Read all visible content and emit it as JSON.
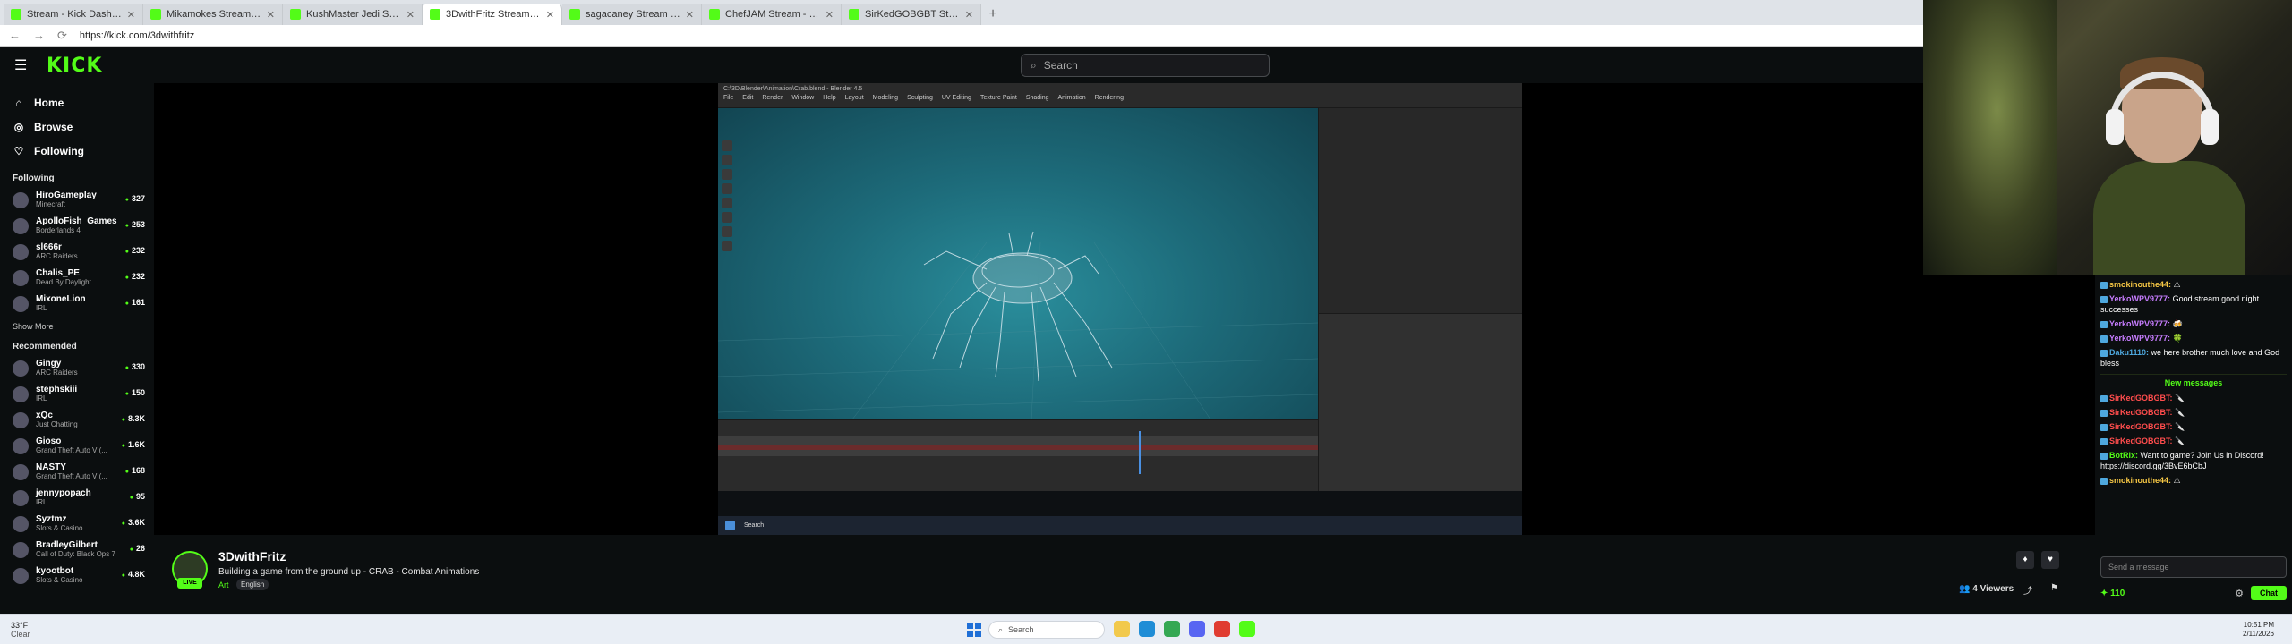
{
  "browser": {
    "tabs": [
      {
        "title": "Stream - Kick Dashboard",
        "active": false
      },
      {
        "title": "Mikamokes Stream - Watch Live o...",
        "active": false
      },
      {
        "title": "KushMaster Jedi Stream - Watch Li...",
        "active": false
      },
      {
        "title": "3DwithFritz Stream - Watch Live o...",
        "active": true
      },
      {
        "title": "sagacaney Stream - Watch Live o...",
        "active": false
      },
      {
        "title": "ChefJAM Stream - Watch Live on K...",
        "active": false
      },
      {
        "title": "SirKedGOBGBT Stream - Watch Live...",
        "active": false
      }
    ],
    "url": "https://kick.com/3dwithfritz"
  },
  "header": {
    "logo": "KICK",
    "search_placeholder": "Search"
  },
  "sidebar": {
    "nav": [
      {
        "label": "Home",
        "icon": "home-icon"
      },
      {
        "label": "Browse",
        "icon": "compass-icon"
      },
      {
        "label": "Following",
        "icon": "heart-icon"
      }
    ],
    "following_title": "Following",
    "following": [
      {
        "name": "HiroGameplay",
        "category": "Minecraft",
        "viewers": "327"
      },
      {
        "name": "ApolloFish_Games",
        "category": "Borderlands 4",
        "viewers": "253"
      },
      {
        "name": "sl666r",
        "category": "ARC Raiders",
        "viewers": "232"
      },
      {
        "name": "Chalis_PE",
        "category": "Dead By Daylight",
        "viewers": "232"
      },
      {
        "name": "MixoneLion",
        "category": "IRL",
        "viewers": "161"
      }
    ],
    "show_more": "Show More",
    "recommended_title": "Recommended",
    "recommended": [
      {
        "name": "Gingy",
        "category": "ARC Raiders",
        "viewers": "330"
      },
      {
        "name": "stephskiii",
        "category": "IRL",
        "viewers": "150"
      },
      {
        "name": "xQc",
        "category": "Just Chatting",
        "viewers": "8.3K"
      },
      {
        "name": "Gioso",
        "category": "Grand Theft Auto V (...",
        "viewers": "1.6K"
      },
      {
        "name": "NASTY",
        "category": "Grand Theft Auto V (...",
        "viewers": "168"
      },
      {
        "name": "jennypopach",
        "category": "IRL",
        "viewers": "95"
      },
      {
        "name": "Syztmz",
        "category": "Slots & Casino",
        "viewers": "3.6K"
      },
      {
        "name": "BradleyGilbert",
        "category": "Call of Duty: Black Ops 7",
        "viewers": "26"
      },
      {
        "name": "kyootbot",
        "category": "Slots & Casino",
        "viewers": "4.8K"
      }
    ]
  },
  "player": {
    "blender_title": "C:\\3D\\Blender\\Animation\\Crab.blend - Blender 4.5",
    "blender_menus": [
      "File",
      "Edit",
      "Render",
      "Window",
      "Help",
      "Layout",
      "Modeling",
      "Sculpting",
      "UV Editing",
      "Texture Paint",
      "Shading",
      "Animation",
      "Rendering"
    ],
    "taskbar_search": "Search"
  },
  "stream": {
    "streamer": "3DwithFritz",
    "live_badge": "LIVE",
    "title": "Building a game from the ground up - CRAB - Combat Animations",
    "category": "Art",
    "tag": "English",
    "viewers": "4 Viewers"
  },
  "chat": {
    "messages": [
      {
        "user": "smokinouthe44:",
        "text": "⚠",
        "color": "#f6c744"
      },
      {
        "user": "YerkoWPV9777:",
        "text": "Good stream good night successes",
        "color": "#c77dff"
      },
      {
        "user": "YerkoWPV9777:",
        "text": "🍻",
        "color": "#c77dff"
      },
      {
        "user": "YerkoWPV9777:",
        "text": "🍀",
        "color": "#c77dff"
      },
      {
        "user": "Daku1110:",
        "text": "we here brother much love and God bless",
        "color": "#4ea8de"
      }
    ],
    "new_messages_label": "New messages",
    "new_messages": [
      {
        "user": "SirKedGOBGBT:",
        "text": "🔪",
        "color": "#ff4d4d"
      },
      {
        "user": "SirKedGOBGBT:",
        "text": "🔪",
        "color": "#ff4d4d"
      },
      {
        "user": "SirKedGOBGBT:",
        "text": "🔪",
        "color": "#ff4d4d"
      },
      {
        "user": "SirKedGOBGBT:",
        "text": "🔪",
        "color": "#ff4d4d"
      },
      {
        "user": "BotRix:",
        "text": "Want to game? Join Us in Discord! https://discord.gg/3BvE6bCbJ",
        "color": "#53fc18"
      },
      {
        "user": "smokinouthe44:",
        "text": "⚠",
        "color": "#f6c744"
      }
    ],
    "input_placeholder": "Send a message",
    "points": "110",
    "send_label": "Chat"
  },
  "taskbar": {
    "weather_temp": "33°F",
    "weather_desc": "Clear",
    "search": "Search",
    "time": "10:51 PM",
    "date": "2/11/2026"
  },
  "colors": {
    "accent": "#53fc18",
    "background": "#0b0e0f"
  }
}
